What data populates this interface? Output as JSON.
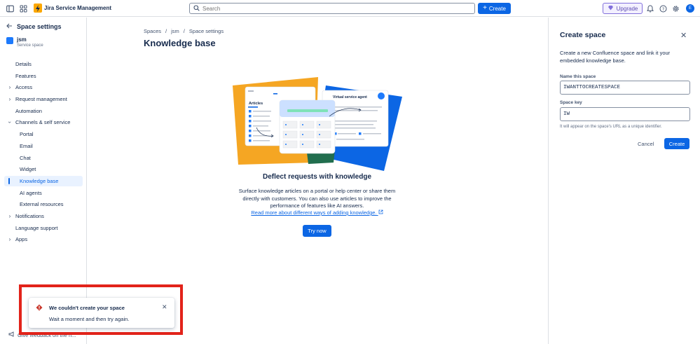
{
  "topbar": {
    "app_title": "Jira Service Management",
    "search_placeholder": "Search",
    "create_label": "Create",
    "upgrade_label": "Upgrade",
    "avatar_initial": "E",
    "icons": [
      "sidebar-toggle-icon",
      "app-switcher-icon",
      "bell-icon",
      "help-icon",
      "gear-icon"
    ]
  },
  "sidebar": {
    "title": "Space settings",
    "space_name": "jsm",
    "space_type": "Service space",
    "items": [
      {
        "label": "Details"
      },
      {
        "label": "Features"
      },
      {
        "label": "Access"
      },
      {
        "label": "Request management"
      },
      {
        "label": "Automation"
      },
      {
        "label": "Channels & self service"
      },
      {
        "label": "Portal"
      },
      {
        "label": "Email"
      },
      {
        "label": "Chat"
      },
      {
        "label": "Widget"
      },
      {
        "label": "Knowledge base"
      },
      {
        "label": "AI agents"
      },
      {
        "label": "External resources"
      },
      {
        "label": "Notifications"
      },
      {
        "label": "Language support"
      },
      {
        "label": "Apps"
      }
    ],
    "feedback": "Give feedback on the n..."
  },
  "main": {
    "breadcrumb": [
      "Spaces",
      "jsm",
      "Space settings"
    ],
    "title": "Knowledge base",
    "illustration": {
      "articles_label": "Articles",
      "agent_label": "Virtual service agent"
    },
    "deflect_title": "Deflect requests with knowledge",
    "deflect_desc": "Surface knowledge articles on a portal or help center or share them directly with customers. You can also use articles to improve the performance of features like AI answers.",
    "read_more": "Read more about different ways of adding knowledge.",
    "try_now": "Try now"
  },
  "panel": {
    "title": "Create space",
    "description": "Create a new Confluence space and link it your embedded knowledge base.",
    "name_label": "Name this space",
    "name_value": "IWANTTOCREATESPACE",
    "key_label": "Space key",
    "key_value": "IW",
    "helper": "It will appear on the space's URL as a unique identifier.",
    "cancel_label": "Cancel",
    "create_label": "Create"
  },
  "flag": {
    "title": "We couldn't create your space",
    "description": "Wait a moment and then try again."
  },
  "colors": {
    "brand": "#0c66e4",
    "error": "#e2231a",
    "upgrade": "#8270db",
    "logo": "#fca700"
  }
}
